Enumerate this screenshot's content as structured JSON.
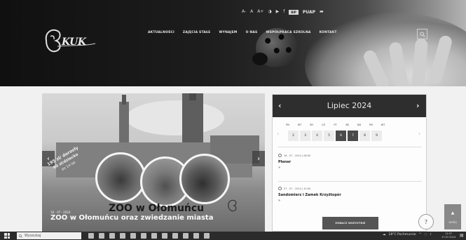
{
  "topbar": {
    "badge": "BIP",
    "brand": "PUAP"
  },
  "logo": {
    "text": "KUK"
  },
  "nav": [
    "AKTUALNOŚCI",
    "ZAJĘCIA STAŁE",
    "WYNAJEM",
    "O NAS",
    "WSPÓŁPRACA SZKOLNA",
    "KONTAKT"
  ],
  "slider": {
    "ribbon_lines": [
      "195 zł/ dorosły",
      "90 zł/dziecko",
      "do 14 lat"
    ],
    "headline": "ZOO w Ołomuńcu",
    "date": "18 - 07 - 2024",
    "title": "ZOO w Ołomuńcu oraz zwiedzanie miasta",
    "logo_text": "KUK"
  },
  "calendar": {
    "month": "Lipiec 2024",
    "day_names": [
      "PN",
      "WT",
      "ŚR",
      "CZ",
      "PT",
      "SB",
      "ND",
      "PN",
      "WT"
    ],
    "days": [
      "2",
      "3",
      "4",
      "5",
      "6",
      "7",
      "8",
      "9"
    ],
    "selected_index": [
      4,
      5
    ],
    "events": [
      {
        "date": "18 - 07 - 2024 | 08:00",
        "title": "Plener",
        "more": "»"
      },
      {
        "date": "27 - 07 - 2024 | 10:00",
        "title": "Sandomierz i Zamek Krzyżtopór",
        "more": "»"
      }
    ],
    "button": "ZOBACZ WSZYSTKIE"
  },
  "scroll_top_label": "WYŻEJ",
  "taskbar": {
    "search_placeholder": "Wyszukaj",
    "tray_text": "18°C Pochmurnie",
    "time": "11:07",
    "date": "17.07.2024"
  }
}
